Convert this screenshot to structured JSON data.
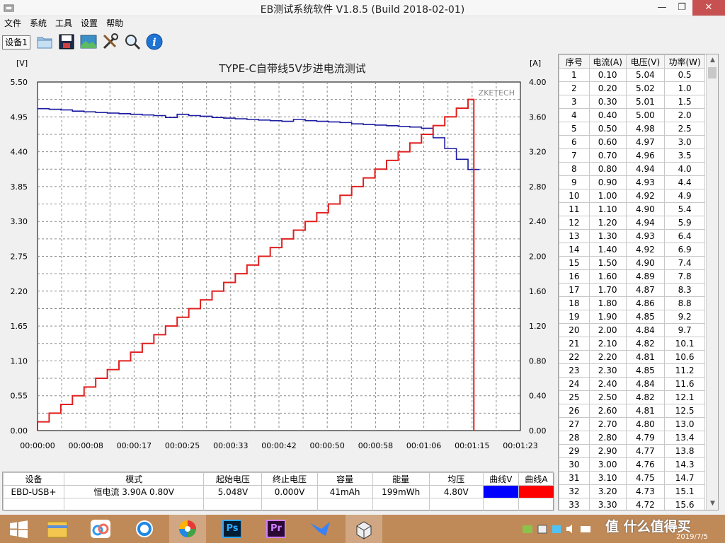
{
  "window": {
    "title": "EB测试系统软件 V1.8.5 (Build 2018-02-01)",
    "controls": {
      "minimize": "—",
      "maximize": "❐",
      "close": "✕"
    }
  },
  "menu": [
    "文件",
    "系统",
    "工具",
    "设置",
    "帮助"
  ],
  "toolbar": {
    "device_tab": "设备1",
    "icons": [
      "folder-icon",
      "save-icon",
      "picture-icon",
      "tools-icon",
      "search-icon",
      "info-icon"
    ]
  },
  "chart": {
    "title": "TYPE-C自带线5V步进电流测试",
    "left_unit": "[V]",
    "right_unit": "[A]",
    "watermark": "ZKETECH",
    "left_ticks": [
      "5.50",
      "4.95",
      "4.40",
      "3.85",
      "3.30",
      "2.75",
      "2.20",
      "1.65",
      "1.10",
      "0.55",
      "0.00"
    ],
    "right_ticks": [
      "4.00",
      "3.60",
      "3.20",
      "2.80",
      "2.40",
      "2.00",
      "1.60",
      "1.20",
      "0.80",
      "0.40",
      "0.00"
    ],
    "x_ticks": [
      "00:00:00",
      "00:00:08",
      "00:00:17",
      "00:00:25",
      "00:00:33",
      "00:00:42",
      "00:00:50",
      "00:00:58",
      "00:01:06",
      "00:01:15",
      "00:01:23"
    ]
  },
  "chart_data": {
    "type": "line",
    "title": "TYPE-C自带线5V步进电流测试",
    "xlabel": "",
    "ylabel": "[V]",
    "y2label": "[A]",
    "ylim": [
      0,
      5.5
    ],
    "y2lim": [
      0,
      4.0
    ],
    "xlim_seconds": [
      0,
      83
    ],
    "grid": true,
    "series": [
      {
        "color": "#1a1aa0",
        "axis": "left",
        "x": [
          0,
          2,
          4,
          6,
          8,
          10,
          12,
          14,
          16,
          18,
          20,
          22,
          24,
          26,
          28,
          30,
          32,
          34,
          36,
          38,
          40,
          42,
          44,
          46,
          48,
          50,
          52,
          54,
          56,
          58,
          60,
          62,
          64,
          66,
          68,
          70,
          72,
          74,
          75
        ],
        "values": [
          5.08,
          5.07,
          5.06,
          5.04,
          5.03,
          5.02,
          5.01,
          5.0,
          4.99,
          4.98,
          4.97,
          4.94,
          4.99,
          4.97,
          4.96,
          4.94,
          4.93,
          4.92,
          4.91,
          4.9,
          4.89,
          4.88,
          4.91,
          4.89,
          4.88,
          4.87,
          4.86,
          4.84,
          4.83,
          4.82,
          4.81,
          4.8,
          4.79,
          4.77,
          4.62,
          4.45,
          4.28,
          4.12,
          4.12
        ]
      },
      {
        "color": "#e02020",
        "axis": "right",
        "x": [
          0,
          2,
          4,
          6,
          8,
          10,
          12,
          14,
          16,
          18,
          20,
          22,
          24,
          26,
          28,
          30,
          32,
          34,
          36,
          38,
          40,
          42,
          44,
          46,
          48,
          50,
          52,
          54,
          56,
          58,
          60,
          62,
          64,
          66,
          68,
          70,
          72,
          74,
          75
        ],
        "values": [
          0.1,
          0.2,
          0.3,
          0.4,
          0.5,
          0.6,
          0.7,
          0.8,
          0.9,
          1.0,
          1.1,
          1.2,
          1.3,
          1.4,
          1.5,
          1.6,
          1.7,
          1.8,
          1.9,
          2.0,
          2.1,
          2.2,
          2.3,
          2.4,
          2.5,
          2.6,
          2.7,
          2.8,
          2.9,
          3.0,
          3.1,
          3.2,
          3.3,
          3.4,
          3.5,
          3.6,
          3.7,
          3.8,
          0.0
        ]
      }
    ]
  },
  "table": {
    "headers": [
      "序号",
      "电流(A)",
      "电压(V)",
      "功率(W)"
    ],
    "rows": [
      [
        "1",
        "0.10",
        "5.04",
        "0.5"
      ],
      [
        "2",
        "0.20",
        "5.02",
        "1.0"
      ],
      [
        "3",
        "0.30",
        "5.01",
        "1.5"
      ],
      [
        "4",
        "0.40",
        "5.00",
        "2.0"
      ],
      [
        "5",
        "0.50",
        "4.98",
        "2.5"
      ],
      [
        "6",
        "0.60",
        "4.97",
        "3.0"
      ],
      [
        "7",
        "0.70",
        "4.96",
        "3.5"
      ],
      [
        "8",
        "0.80",
        "4.94",
        "4.0"
      ],
      [
        "9",
        "0.90",
        "4.93",
        "4.4"
      ],
      [
        "10",
        "1.00",
        "4.92",
        "4.9"
      ],
      [
        "11",
        "1.10",
        "4.90",
        "5.4"
      ],
      [
        "12",
        "1.20",
        "4.94",
        "5.9"
      ],
      [
        "13",
        "1.30",
        "4.93",
        "6.4"
      ],
      [
        "14",
        "1.40",
        "4.92",
        "6.9"
      ],
      [
        "15",
        "1.50",
        "4.90",
        "7.4"
      ],
      [
        "16",
        "1.60",
        "4.89",
        "7.8"
      ],
      [
        "17",
        "1.70",
        "4.87",
        "8.3"
      ],
      [
        "18",
        "1.80",
        "4.86",
        "8.8"
      ],
      [
        "19",
        "1.90",
        "4.85",
        "9.2"
      ],
      [
        "20",
        "2.00",
        "4.84",
        "9.7"
      ],
      [
        "21",
        "2.10",
        "4.82",
        "10.1"
      ],
      [
        "22",
        "2.20",
        "4.81",
        "10.6"
      ],
      [
        "23",
        "2.30",
        "4.85",
        "11.2"
      ],
      [
        "24",
        "2.40",
        "4.84",
        "11.6"
      ],
      [
        "25",
        "2.50",
        "4.82",
        "12.1"
      ],
      [
        "26",
        "2.60",
        "4.81",
        "12.5"
      ],
      [
        "27",
        "2.70",
        "4.80",
        "13.0"
      ],
      [
        "28",
        "2.80",
        "4.79",
        "13.4"
      ],
      [
        "29",
        "2.90",
        "4.77",
        "13.8"
      ],
      [
        "30",
        "3.00",
        "4.76",
        "14.3"
      ],
      [
        "31",
        "3.10",
        "4.75",
        "14.7"
      ],
      [
        "32",
        "3.20",
        "4.73",
        "15.1"
      ],
      [
        "33",
        "3.30",
        "4.72",
        "15.6"
      ]
    ]
  },
  "summary": {
    "headers": [
      "设备",
      "模式",
      "起始电压",
      "终止电压",
      "容量",
      "能量",
      "均压",
      "曲线V",
      "曲线A"
    ],
    "row": [
      "EBD-USB+",
      "恒电流  3.90A  0.80V",
      "5.048V",
      "0.000V",
      "41mAh",
      "199mWh",
      "4.80V",
      "",
      ""
    ],
    "curve_v_color": "#0000ff",
    "curve_a_color": "#ff0000"
  },
  "taskbar": {
    "apps": [
      "windows-start-icon",
      "file-explorer-icon",
      "baidu-netdisk-icon",
      "browser-icon",
      "photos-icon",
      "photoshop-icon",
      "premiere-icon",
      "feishu-icon",
      "eb-test-icon"
    ],
    "photoshop_label": "Ps",
    "premiere_label": "Pr",
    "watermark": "值 什么值得买",
    "date": "2019/7/5"
  }
}
